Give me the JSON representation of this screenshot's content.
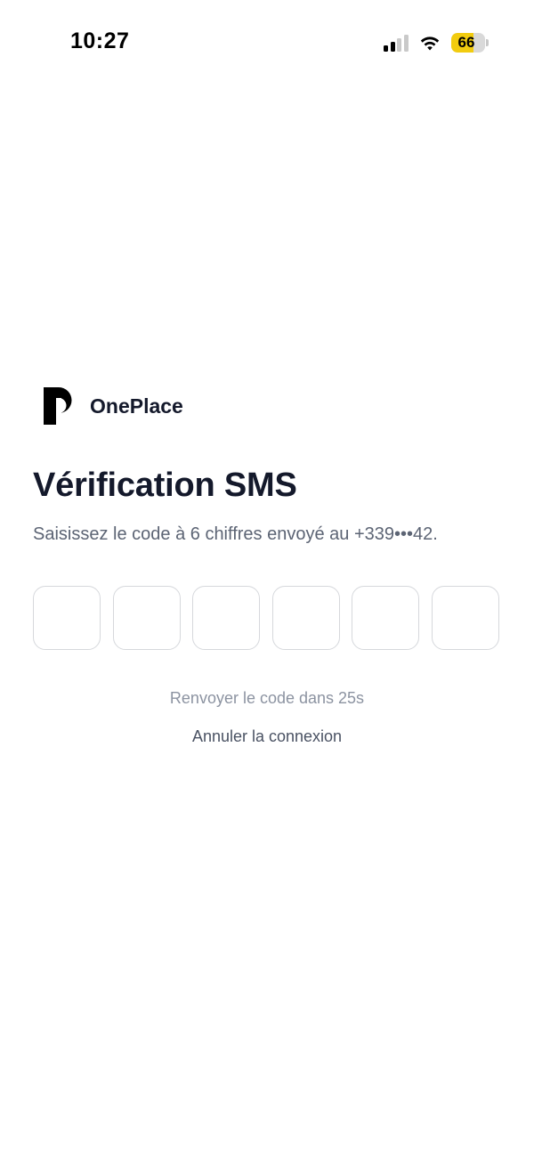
{
  "status_bar": {
    "time": "10:27",
    "battery_level": "66",
    "battery_fraction": 0.66,
    "signal_bars_active": 2,
    "signal_bars_total": 4
  },
  "brand": {
    "name": "OnePlace",
    "logo_icon": "oneplace-logo-icon"
  },
  "verification": {
    "title": "Vérification SMS",
    "subtitle": "Saisissez le code à 6 chiffres envoyé au +339•••42.",
    "code_digits": [
      "",
      "",
      "",
      "",
      "",
      ""
    ],
    "resend_label": "Renvoyer le code dans 25s",
    "cancel_label": "Annuler la connexion"
  },
  "colors": {
    "text_primary": "#14192b",
    "text_secondary": "#5c6474",
    "text_muted": "#8c93a1",
    "input_border": "#d6d8dc",
    "battery_fill": "#f2cc0f"
  }
}
